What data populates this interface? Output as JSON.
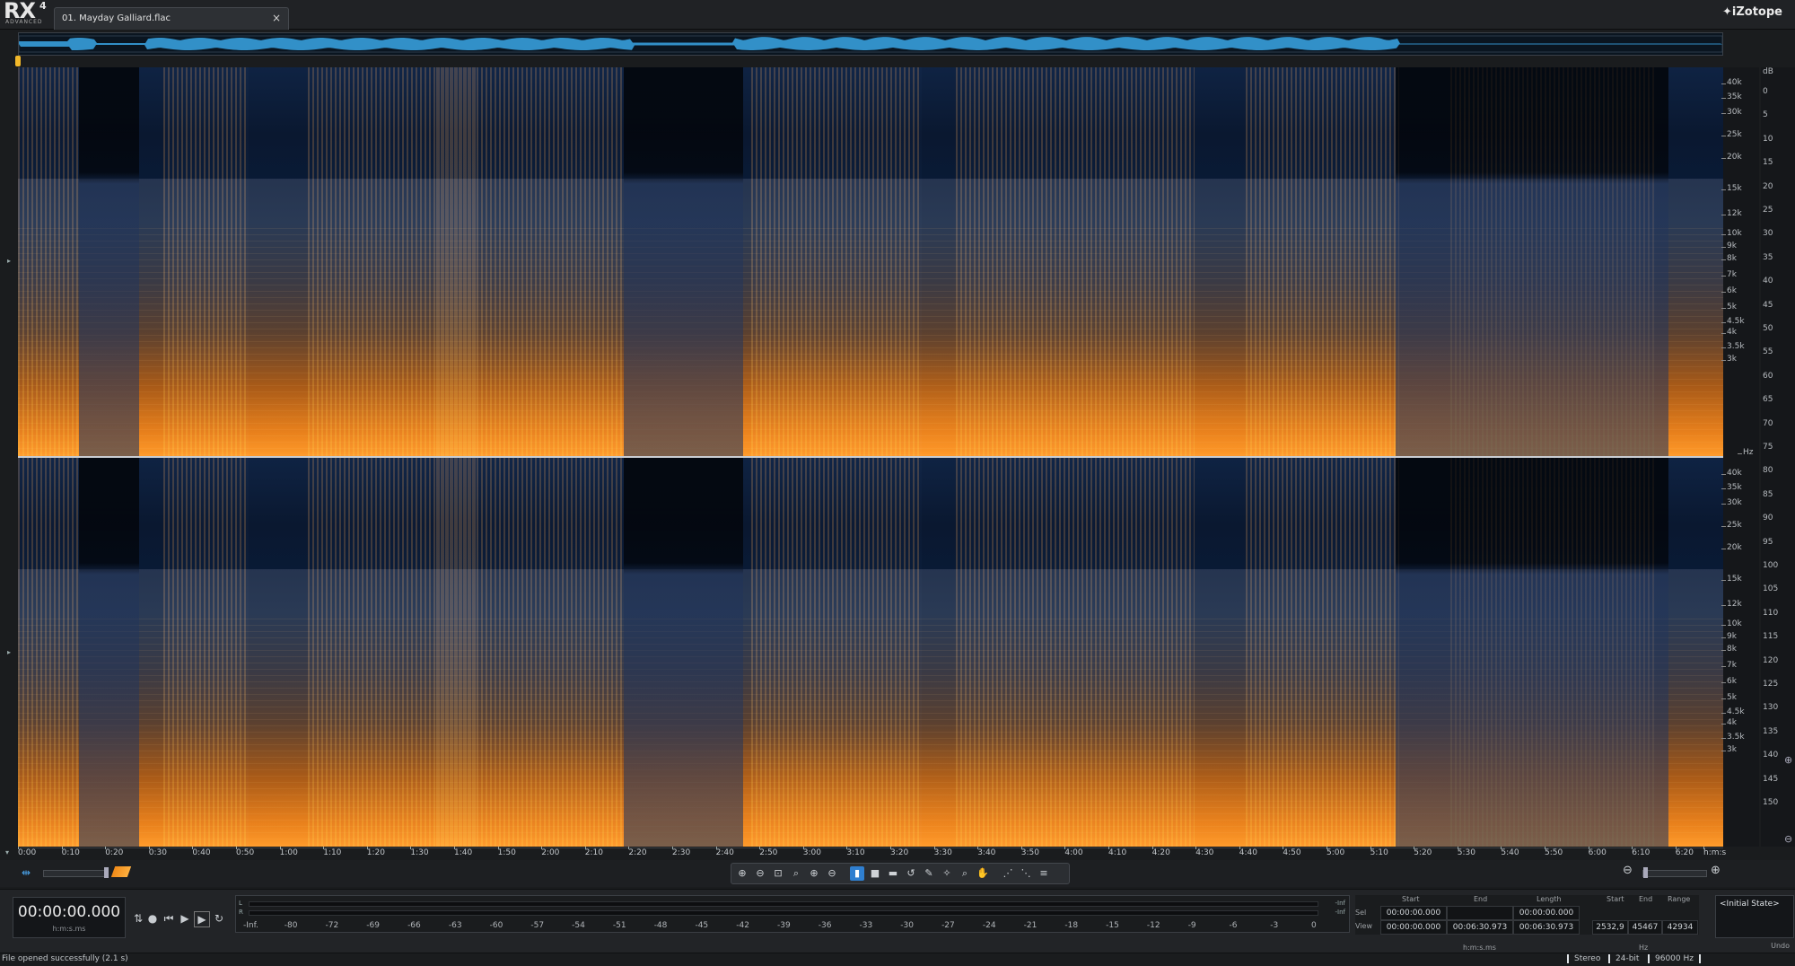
{
  "app": {
    "logo_main": "RX",
    "logo_version": "4",
    "logo_edition": "ADVANCED",
    "brand": "iZotope"
  },
  "tab": {
    "filename": "01. Mayday Galliard.flac",
    "close_glyph": "×"
  },
  "freq_axis": {
    "unit_top": "",
    "unit_hz": "Hz",
    "labels_ch1": [
      "40k",
      "35k",
      "30k",
      "25k",
      "20k",
      "15k",
      "12k",
      "10k",
      "9k",
      "8k",
      "7k",
      "6k",
      "5k",
      "4.5k",
      "4k",
      "3.5k",
      "3k"
    ],
    "labels_ch2": [
      "40k",
      "35k",
      "30k",
      "25k",
      "20k",
      "15k",
      "12k",
      "10k",
      "9k",
      "8k",
      "7k",
      "6k",
      "5k",
      "4.5k",
      "4k",
      "3.5k",
      "3k"
    ]
  },
  "db_axis": {
    "unit": "dB",
    "labels": [
      "0",
      "5",
      "10",
      "15",
      "20",
      "25",
      "30",
      "35",
      "40",
      "45",
      "50",
      "55",
      "60",
      "65",
      "70",
      "75",
      "80",
      "85",
      "90",
      "95",
      "100",
      "105",
      "110",
      "115",
      "120",
      "125",
      "130",
      "135",
      "140",
      "145",
      "150"
    ]
  },
  "time_ruler": {
    "labels": [
      "0:00",
      "0:10",
      "0:20",
      "0:30",
      "0:40",
      "0:50",
      "1:00",
      "1:10",
      "1:20",
      "1:30",
      "1:40",
      "1:50",
      "2:00",
      "2:10",
      "2:20",
      "2:30",
      "2:40",
      "2:50",
      "3:00",
      "3:10",
      "3:20",
      "3:30",
      "3:40",
      "3:50",
      "4:00",
      "4:10",
      "4:20",
      "4:30",
      "4:40",
      "4:50",
      "5:00",
      "5:10",
      "5:20",
      "5:30",
      "5:40",
      "5:50",
      "6:00",
      "6:10",
      "6:20"
    ],
    "unit": "h:m:s"
  },
  "transport": {
    "timecode": "00:00:00.000",
    "timecode_unit": "h:m:s.ms"
  },
  "meter": {
    "labels": [
      "-Inf.",
      "-80",
      "-72",
      "-69",
      "-66",
      "-63",
      "-60",
      "-57",
      "-54",
      "-51",
      "-48",
      "-45",
      "-42",
      "-39",
      "-36",
      "-33",
      "-30",
      "-27",
      "-24",
      "-21",
      "-18",
      "-15",
      "-12",
      "-9",
      "-6",
      "-3",
      "0"
    ],
    "left_ch": "L",
    "right_ch": "R",
    "right_top": "-Inf",
    "right_bottom": "-Inf"
  },
  "selection": {
    "time_headers": [
      "Start",
      "End",
      "Length"
    ],
    "freq_headers": [
      "Start",
      "End",
      "Range"
    ],
    "row_sel": "Sel",
    "row_view": "View",
    "sel_values": [
      "00:00:00.000",
      "",
      "00:00:00.000"
    ],
    "view_values": [
      "00:00:00.000",
      "00:06:30.973",
      "00:06:30.973"
    ],
    "freq_values": [
      "2532,9",
      "45467",
      "42934"
    ],
    "time_unit": "h:m:s.ms",
    "freq_unit": "Hz"
  },
  "undo": {
    "state": "<Initial State>",
    "label": "Undo"
  },
  "status": {
    "message": "File opened successfully (2.1 s)",
    "channels": "Stereo",
    "bit_depth": "24-bit",
    "sample_rate": "96000 Hz"
  },
  "colors": {
    "accent": "#2f7fd0",
    "spectrum_hot": "#ff9a2a",
    "spectrum_cold": "#0b1a30",
    "waveform": "#3aa6e6"
  }
}
